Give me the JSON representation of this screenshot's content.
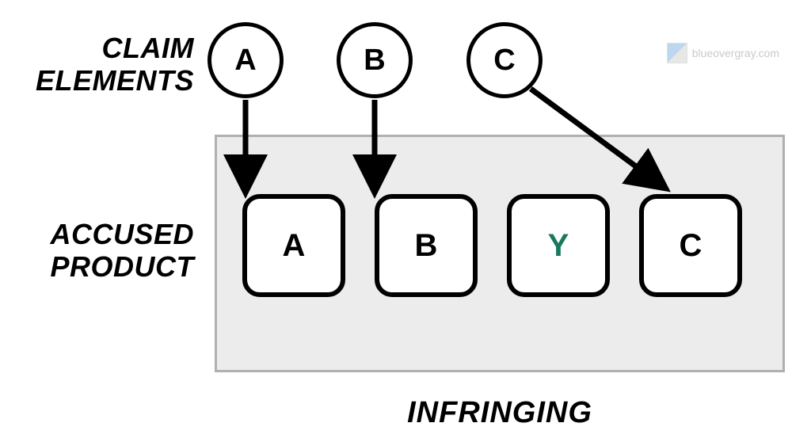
{
  "labels": {
    "claim_elements": "CLAIM ELEMENTS",
    "accused_product": "ACCUSED PRODUCT",
    "verdict": "INFRINGING"
  },
  "claim_circles": {
    "a": "A",
    "b": "B",
    "c": "C"
  },
  "product_squares": {
    "a": "A",
    "b": "B",
    "y": "Y",
    "c": "C"
  },
  "colors": {
    "highlight": "#187a5c",
    "box_bg": "#ececec",
    "box_border": "#b0b0b0"
  },
  "watermark": {
    "text": "blueovergray.com"
  },
  "mappings": [
    {
      "from": "A",
      "to": "A"
    },
    {
      "from": "B",
      "to": "B"
    },
    {
      "from": "C",
      "to": "C"
    }
  ]
}
